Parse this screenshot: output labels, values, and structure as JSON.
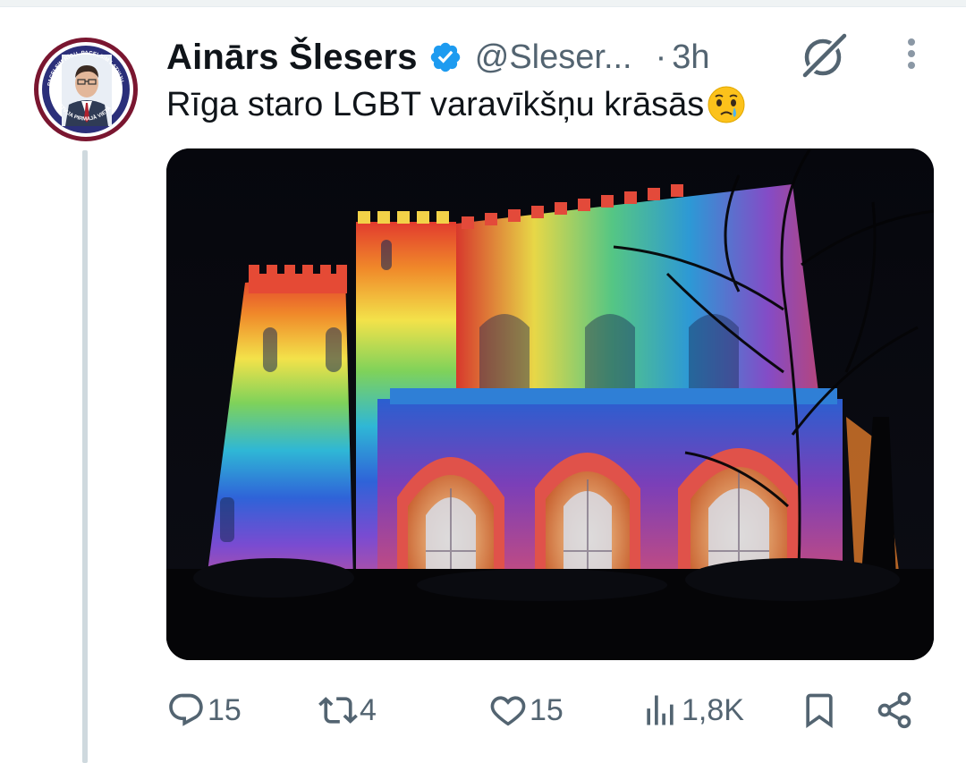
{
  "tweet": {
    "author_name": "Ainārs Šlesers",
    "handle": "@Sleser...",
    "separator": "·",
    "time": "3h",
    "text": "Rīga staro LGBT varavīkšņu krāsās",
    "text_emoji": "crying-face-emoji",
    "verified": true,
    "accent_color": "#1d9bf0",
    "avatar_ring_text": "PACELSIM RĪGU, PACELSIM LATVIJU · LATVIJA PIRMAJĀ VIETĀ"
  },
  "actions": {
    "replies": "15",
    "reposts": "4",
    "likes": "15",
    "views": "1,8K"
  },
  "icons": [
    "reply-icon",
    "repost-icon",
    "like-icon",
    "views-icon",
    "bookmark-icon",
    "share-icon",
    "grok-icon",
    "more-icon",
    "verified-badge-icon"
  ]
}
